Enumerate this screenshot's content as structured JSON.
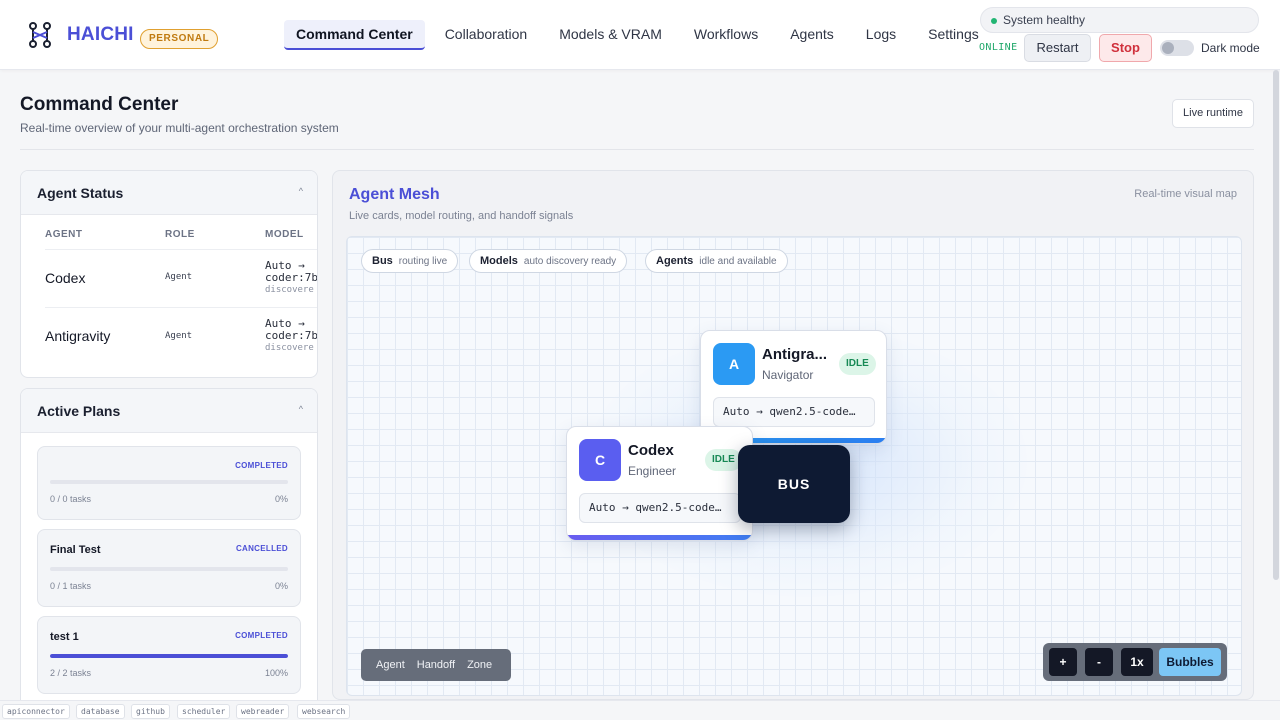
{
  "header": {
    "brand": "HAICHI",
    "badge": "PERSONAL",
    "nav": [
      "Command Center",
      "Collaboration",
      "Models & VRAM",
      "Workflows",
      "Agents",
      "Logs",
      "Settings"
    ],
    "active_nav": "Command Center",
    "health": "System healthy",
    "online": "ONLINE",
    "restart": "Restart",
    "stop": "Stop",
    "dark_mode": "Dark mode"
  },
  "page": {
    "title": "Command Center",
    "subtitle": "Real-time overview of your multi-agent orchestration system",
    "live_runtime": "Live runtime"
  },
  "agent_status": {
    "title": "Agent Status",
    "columns": [
      "AGENT",
      "ROLE",
      "MODEL"
    ],
    "rows": [
      {
        "name": "Codex",
        "role": "Agent",
        "model_line1": "Auto →",
        "model_line2": "coder:7b",
        "model_line3": "discovere"
      },
      {
        "name": "Antigravity",
        "role": "Agent",
        "model_line1": "Auto →",
        "model_line2": "coder:7b",
        "model_line3": "discovere"
      }
    ]
  },
  "active_plans": {
    "title": "Active Plans",
    "plans": [
      {
        "name": "",
        "status": "COMPLETED",
        "tasks": "0 / 0 tasks",
        "percent": "0%",
        "progress": 0
      },
      {
        "name": "Final Test",
        "status": "CANCELLED",
        "tasks": "0 / 1 tasks",
        "percent": "0%",
        "progress": 0
      },
      {
        "name": "test 1",
        "status": "COMPLETED",
        "tasks": "2 / 2 tasks",
        "percent": "100%",
        "progress": 100
      }
    ]
  },
  "mesh": {
    "title": "Agent Mesh",
    "subtitle": "Live cards, model routing, and handoff signals",
    "right_label": "Real-time visual map",
    "pills": [
      {
        "key": "Bus",
        "value": "routing live"
      },
      {
        "key": "Models",
        "value": "auto discovery ready"
      },
      {
        "key": "Agents",
        "value": "idle and available"
      }
    ],
    "nodes": [
      {
        "initial": "A",
        "name": "Antigra...",
        "role": "Navigator",
        "status": "IDLE",
        "route": "Auto → qwen2.5-code…",
        "color": "#2b9af3"
      },
      {
        "initial": "C",
        "name": "Codex",
        "role": "Engineer",
        "status": "IDLE",
        "route": "Auto → qwen2.5-code…",
        "color": "#5a5ef0"
      }
    ],
    "bus_label": "BUS",
    "legend": [
      "Agent",
      "Handoff",
      "Zone"
    ],
    "zoom": {
      "plus": "+",
      "minus": "-",
      "level": "1x",
      "bubbles": "Bubbles"
    }
  },
  "footer_chips": [
    "apiconnector",
    "database",
    "github",
    "scheduler",
    "webreader",
    "websearch"
  ],
  "colors": {
    "accent": "#4b4fd6",
    "success": "#22b573",
    "danger": "#d0303c",
    "bus": "#0e1a33"
  }
}
